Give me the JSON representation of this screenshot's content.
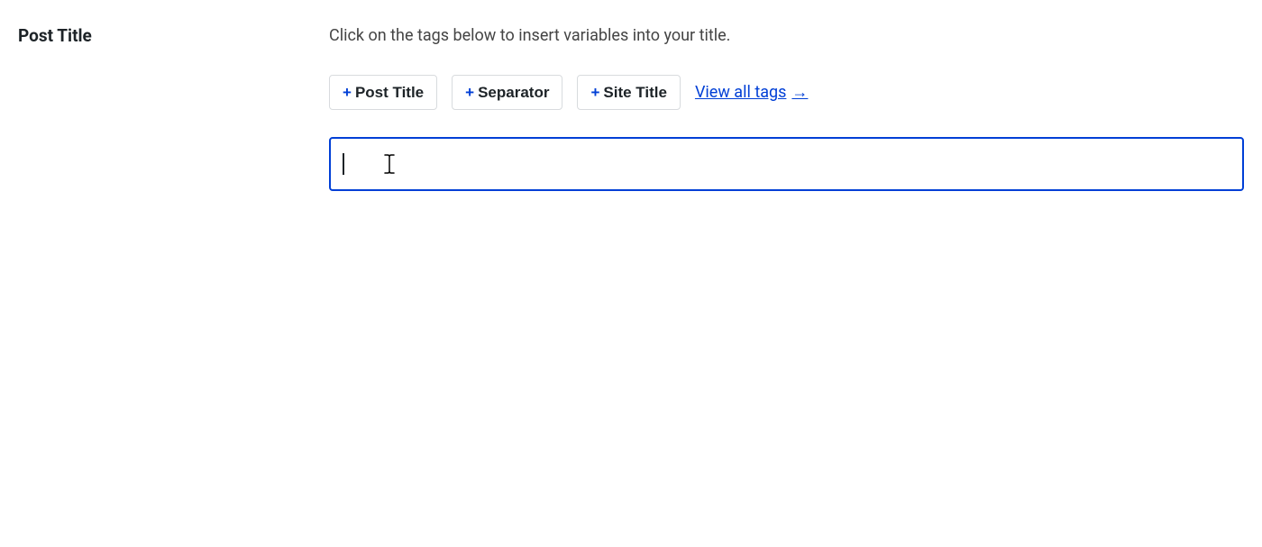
{
  "label": "Post Title",
  "hint": "Click on the tags below to insert variables into your title.",
  "tags": {
    "post_title": "Post Title",
    "separator": "Separator",
    "site_title": "Site Title"
  },
  "view_all": "View all tags",
  "input_value": "",
  "input_placeholder": ""
}
